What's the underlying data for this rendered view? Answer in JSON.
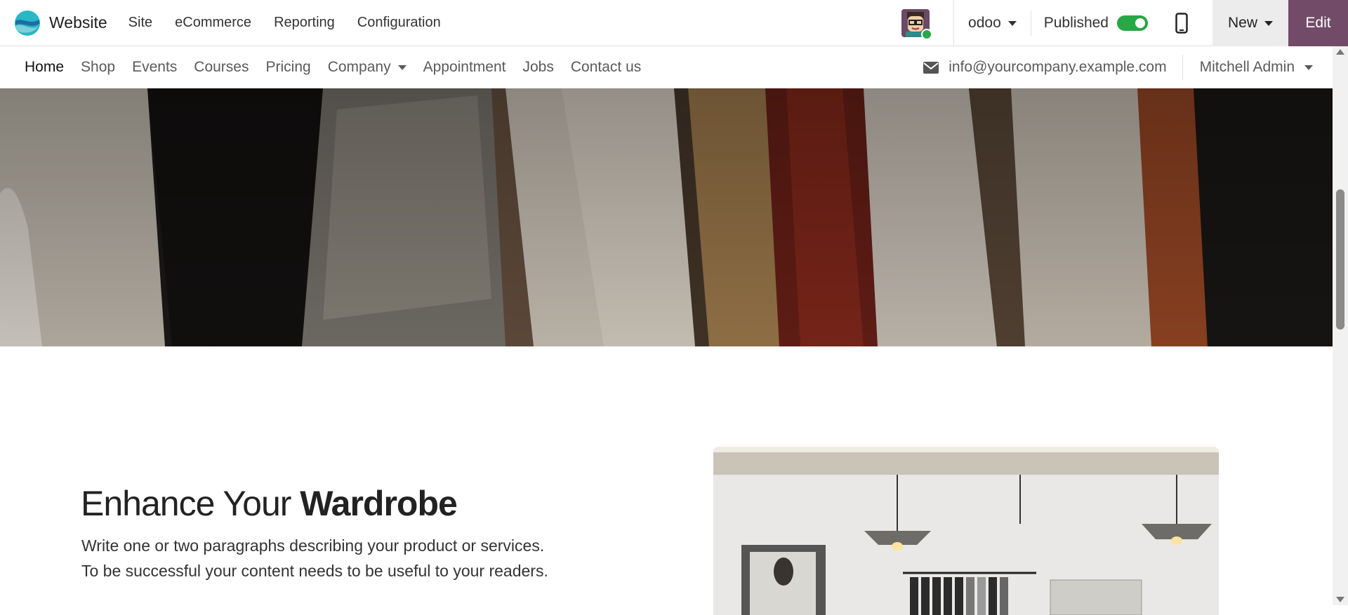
{
  "topbar": {
    "app_name": "Website",
    "menu": [
      "Site",
      "eCommerce",
      "Reporting",
      "Configuration"
    ],
    "website_switcher": "odoo",
    "published_label": "Published",
    "published": true,
    "new_label": "New",
    "edit_label": "Edit",
    "accent_color": "#714b67"
  },
  "sitenav": {
    "links": [
      {
        "label": "Home",
        "active": true
      },
      {
        "label": "Shop"
      },
      {
        "label": "Events"
      },
      {
        "label": "Courses"
      },
      {
        "label": "Pricing"
      },
      {
        "label": "Company",
        "dropdown": true
      },
      {
        "label": "Appointment"
      },
      {
        "label": "Jobs"
      },
      {
        "label": "Contact us"
      }
    ],
    "email": "info@yourcompany.example.com",
    "user": "Mitchell Admin"
  },
  "content": {
    "heading_plain": "Enhance Your ",
    "heading_bold": "Wardrobe",
    "paragraph": "Write one or two paragraphs describing your product or services. To be successful your content needs to be useful to your readers."
  }
}
